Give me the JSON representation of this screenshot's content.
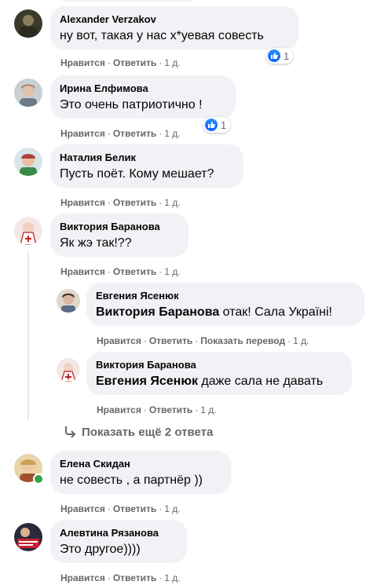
{
  "actions": {
    "like": "Нравится",
    "reply": "Ответить",
    "translate": "Показать перевод"
  },
  "comments": [
    {
      "author": "Alexander Verzakov",
      "text": "ну вот, такая у нас х*уевая совесть",
      "time": "1 д.",
      "reactions": "1"
    },
    {
      "author": "Ирина Елфимова",
      "text": "Это очень патриотично !",
      "time": "1 д.",
      "reactions": "1"
    },
    {
      "author": "Наталия Белик",
      "text": "Пусть поёт. Кому мешает?",
      "time": "1 д."
    },
    {
      "author": "Виктория Баранова",
      "text": "Як жэ так!??",
      "time": "1 д."
    },
    {
      "author": "Елена Скидан",
      "text": "не совесть , а партнёр ))",
      "time": "1 д."
    },
    {
      "author": "Алевтина Рязанова",
      "text": "Это другое))))",
      "time": "1 д."
    }
  ],
  "replies": [
    {
      "author": "Евгения Ясенюк",
      "mention": "Виктория Баранова",
      "text": " отак! Сала Україні!",
      "time": "1 д."
    },
    {
      "author": "Виктория Баранова",
      "mention": "Евгения Ясенюк",
      "text": " даже сала не давать",
      "time": "1 д."
    }
  ],
  "more_replies_label": "Показать ещё 2 ответа",
  "colors": {
    "bubble": "#f0f2f5",
    "meta": "#65676b",
    "like": "#0866ff",
    "online": "#31a24c"
  }
}
